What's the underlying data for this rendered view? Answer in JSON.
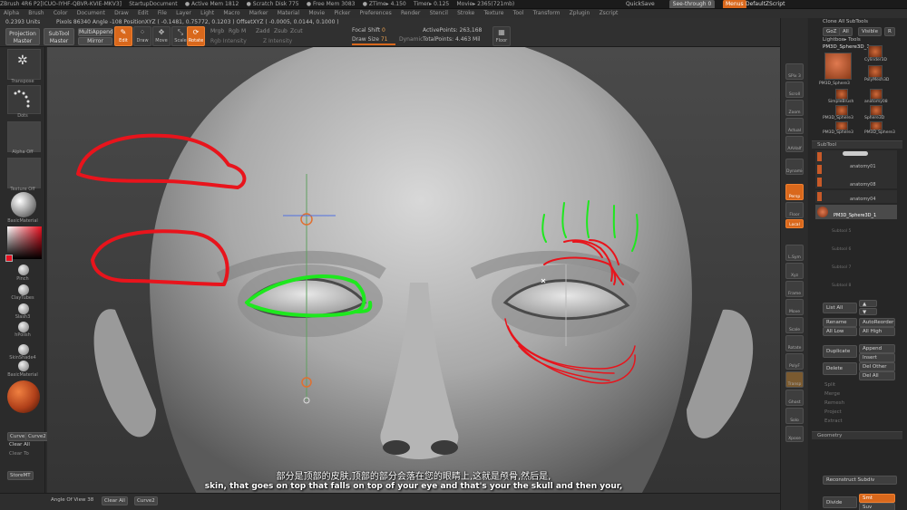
{
  "titlebar": {
    "items": [
      "ZBrush 4R6 P2[ICUO-IYHF-QBVR-KVIE-MKV3]",
      "StartupDocument",
      "● Active Mem 1812",
      "● Scratch Disk 775",
      "● Free Mem 3083",
      "● ZTime▸ 4.150",
      "Timer▸ 0.125",
      "Movie▸ 2365(721mb)"
    ],
    "quicksave": "QuickSave",
    "seethrough": "See-through  0",
    "menus": "Menus",
    "script": "DefaultZScript"
  },
  "menubar": [
    "Alpha",
    "Brush",
    "Color",
    "Document",
    "Draw",
    "Edit",
    "File",
    "Layer",
    "Light",
    "Macro",
    "Marker",
    "Material",
    "Movie",
    "Picker",
    "Preferences",
    "Render",
    "Stencil",
    "Stroke",
    "Texture",
    "Tool",
    "Transform",
    "Zplugin",
    "Zscript"
  ],
  "shelf": {
    "coords_a": "0.2393  Units",
    "coords_b": "Pixols 86340  Angle -108  PositionXYZ  ( -0.1481, 0.75772, 0.1203 )  OffsetXYZ  ( -0.0005, 0.0144, 0.1000 )",
    "projection_master": "Projection Master",
    "subtool_master": "SubTool Master",
    "multiappend": "MultiAppend",
    "mirror": "Mirror",
    "tools": [
      "Edit",
      "Draw",
      "Move",
      "Scale",
      "Rotate"
    ],
    "mrgb": "Mrgb",
    "rgb": "Rgb",
    "m": "M",
    "zadd": "Zadd",
    "zsub": "Zsub",
    "zcut": "Zcut",
    "rgb_intensity": "Rgb Intensity",
    "z_intensity": "Z Intensity",
    "focal_shift_label": "Focal Shift",
    "focal_shift_value": "0",
    "draw_size_label": "Draw Size",
    "draw_size_value": "71",
    "dynamic": "Dynamic",
    "active_points": "ActivePoints: 263,168",
    "total_points": "TotalPoints: 4.463 Mil",
    "floor": "Floor"
  },
  "lefttray": {
    "transpose": "Transpose",
    "dots": "Dots",
    "alpha_off": "Alpha Off",
    "texture_off": "Texture Off",
    "basic_material": "BasicMaterial",
    "brushes": [
      "Pinch",
      "ClayTubes",
      "Slash3",
      "hPolish",
      "SkinShade4"
    ],
    "basic_material2": "BasicMaterial",
    "curve1": "Curve1",
    "curve2": "Curve2",
    "clear_all": "Clear All",
    "clear_to": "Clear To",
    "store_mt": "StoreMT"
  },
  "rightbar": [
    "SPix 3",
    "Scroll",
    "Zoom",
    "Actual",
    "AAHalf",
    "Dynamic",
    "Persp",
    "Floor",
    "Local",
    "L.Sym",
    "Xyz",
    "Frame",
    "Move",
    "Scale",
    "Rotate",
    "PolyF",
    "Transp",
    "Ghost",
    "Solo",
    "Xpose"
  ],
  "rightpanel": {
    "clone_all": "Clone  All SubTools",
    "goz": "GoZ",
    "all": "All",
    "visible": "Visible",
    "r": "R",
    "lightbox_tools": "Lightbox▸ Tools",
    "current_tool": "PM3D_Sphere3D_1",
    "tool_thumbs": [
      "PM3D_Sphere3",
      "Cylinder3D",
      "PolyMesh3D",
      "SimpleBrush",
      "anatomy08",
      "PM3D_Sphere3",
      "Sphere3D",
      "PM3D_Sphere3",
      "PM3D_Sphere3"
    ],
    "subtool_header": "SubTool",
    "subtools": [
      "anatomy01",
      "anatomy08",
      "anatomy04",
      "PM3D_Sphere3D_1"
    ],
    "empty_slots": [
      "Subtool 5",
      "Subtool 6",
      "Subtool 7",
      "Subtool 8"
    ],
    "list_all": "List  All",
    "rename": "Rename",
    "autoreorder": "AutoReorder",
    "all_low": "All Low",
    "all_high": "All High",
    "duplicate": "Duplicate",
    "append": "Append",
    "insert": "Insert",
    "delete": "Delete",
    "del_other": "Del Other",
    "del_all": "Del All",
    "split": "Split",
    "merge": "Merge",
    "remesh": "Remesh",
    "project": "Project",
    "extract": "Extract",
    "geometry": "Geometry",
    "reconstruct_subdiv": "Reconstruct Subdiv",
    "divide": "Divide",
    "smt": "Smt",
    "suv": "Suv"
  },
  "bottombar": {
    "angle_of_view": "Angle Of View 38",
    "clear_all": "Clear All",
    "curve2": "Curve2"
  },
  "subtitles": {
    "zh": "部分是顶部的皮肤,顶部的部分会落在您的眼睛上,这就是颅骨,然后是,",
    "en": "skin, that goes on top that falls on top of your eye and that's your the skull and then your,"
  },
  "colors": {
    "accent": "#d9681c",
    "stroke_red": "#e8141c",
    "stroke_green": "#1ee81e"
  }
}
